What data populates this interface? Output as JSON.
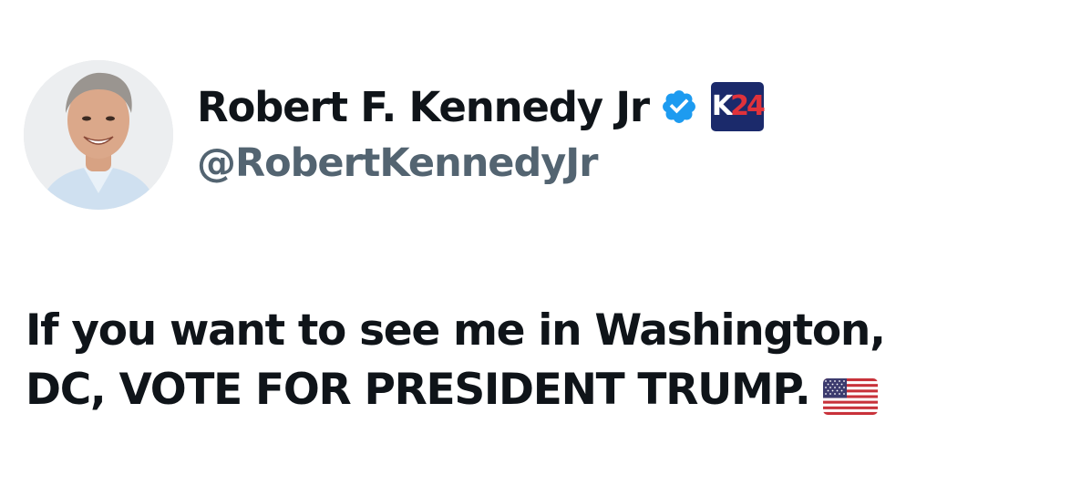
{
  "tweet": {
    "author": {
      "display_name": "Robert F. Kennedy Jr",
      "handle": "@RobertKennedyJr",
      "verified": true,
      "affiliate_badge": {
        "letter": "K",
        "number": "24"
      }
    },
    "text_lines": [
      "If you want to see me in Washington,",
      "DC, VOTE FOR PRESIDENT TRUMP."
    ],
    "emoji": "us-flag-emoji"
  },
  "colors": {
    "text": "#0f1419",
    "secondary_text": "#536471",
    "verified_blue": "#1d9bf0",
    "badge_navy": "#1b2a6b",
    "badge_red": "#e0323b"
  }
}
